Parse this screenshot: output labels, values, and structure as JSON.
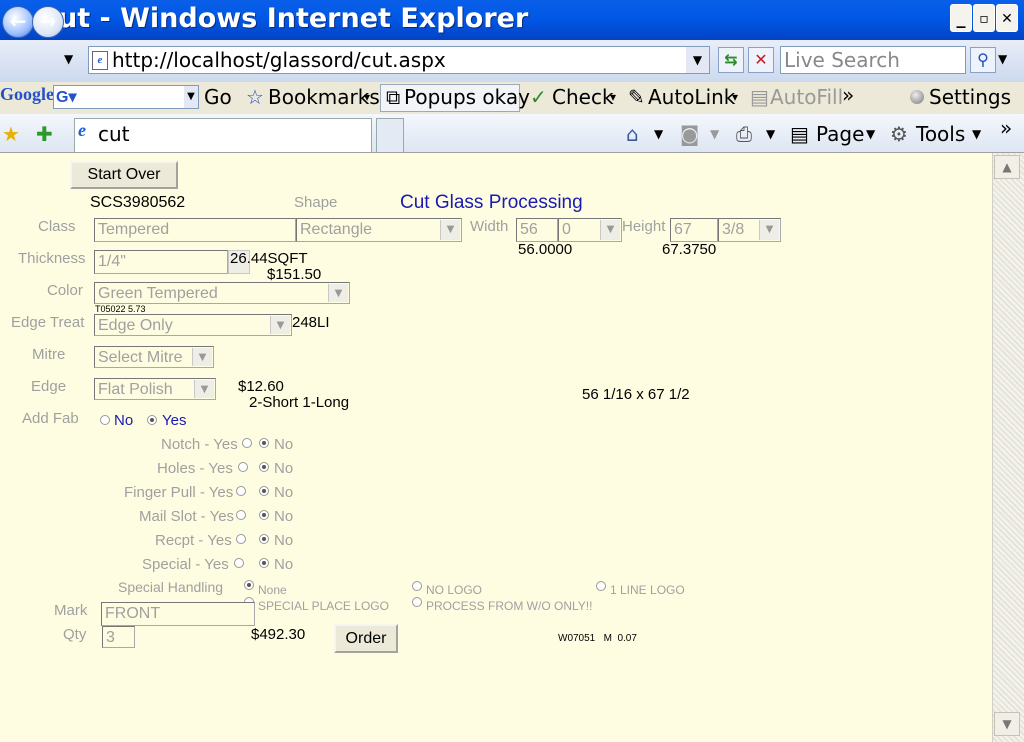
{
  "window": {
    "title": "cut - Windows Internet Explorer",
    "min": "_",
    "restore": "▫",
    "close": "✕"
  },
  "address_bar": {
    "url": "http://localhost/glassord/cut.aspx",
    "search_placeholder": "Live Search"
  },
  "google_toolbar": {
    "logo": "Google",
    "go": "Go",
    "bookmarks": "Bookmarks",
    "popups": "Popups okay",
    "check": "Check",
    "autolink": "AutoLink",
    "autofill": "AutoFill",
    "settings": "Settings"
  },
  "tabs": {
    "tab_title": "cut",
    "page_menu": "Page",
    "tools_menu": "Tools"
  },
  "form": {
    "start_over": "Start Over",
    "order_id": "SCS3980562",
    "shape_label": "Shape",
    "heading": "Cut Glass Processing",
    "class_label": "Class",
    "class_value": "Tempered",
    "shape_value": "Rectangle",
    "width_label": "Width",
    "width_value": "56",
    "width_frac": "0",
    "height_label": "Height",
    "height_value": "67",
    "height_frac": "3/8",
    "width_decimal": "56.0000",
    "height_decimal": "67.3750",
    "thickness_label": "Thickness",
    "thickness_value": "1/4\"",
    "sqft": "26.44SQFT",
    "price1": "$151.50",
    "color_label": "Color",
    "color_value": "Green Tempered",
    "color_code": "T05022 5.73",
    "edge_treat_label": "Edge Treat",
    "edge_treat_value": "Edge Only",
    "li": "248LI",
    "mitre_label": "Mitre",
    "mitre_value": "Select Mitre",
    "edge_label": "Edge",
    "edge_value": "Flat Polish",
    "price2": "$12.60",
    "edge_desc": "2-Short 1-Long",
    "dimension_text": "56 1/16 x 67 1/2",
    "add_fab_label": "Add Fab",
    "no": "No",
    "yes": "Yes",
    "notch_label": "Notch - Yes",
    "holes_label": "Holes - Yes",
    "finger_label": "Finger Pull - Yes",
    "mail_label": "Mail Slot - Yes",
    "recpt_label": "Recpt - Yes",
    "special_label": "Special - Yes",
    "handling_label": "Special Handling",
    "none_opt": "None",
    "nologo_opt": "NO LOGO",
    "oneline_opt": "1 LINE LOGO",
    "special_place_opt": "SPECIAL PLACE LOGO",
    "process_opt": "PROCESS FROM W/O ONLY!!",
    "mark_label": "Mark",
    "mark_value": "FRONT",
    "qty_label": "Qty",
    "qty_value": "3",
    "total": "$492.30",
    "order_button": "Order",
    "footer_code": "W07051   M  0.07"
  }
}
